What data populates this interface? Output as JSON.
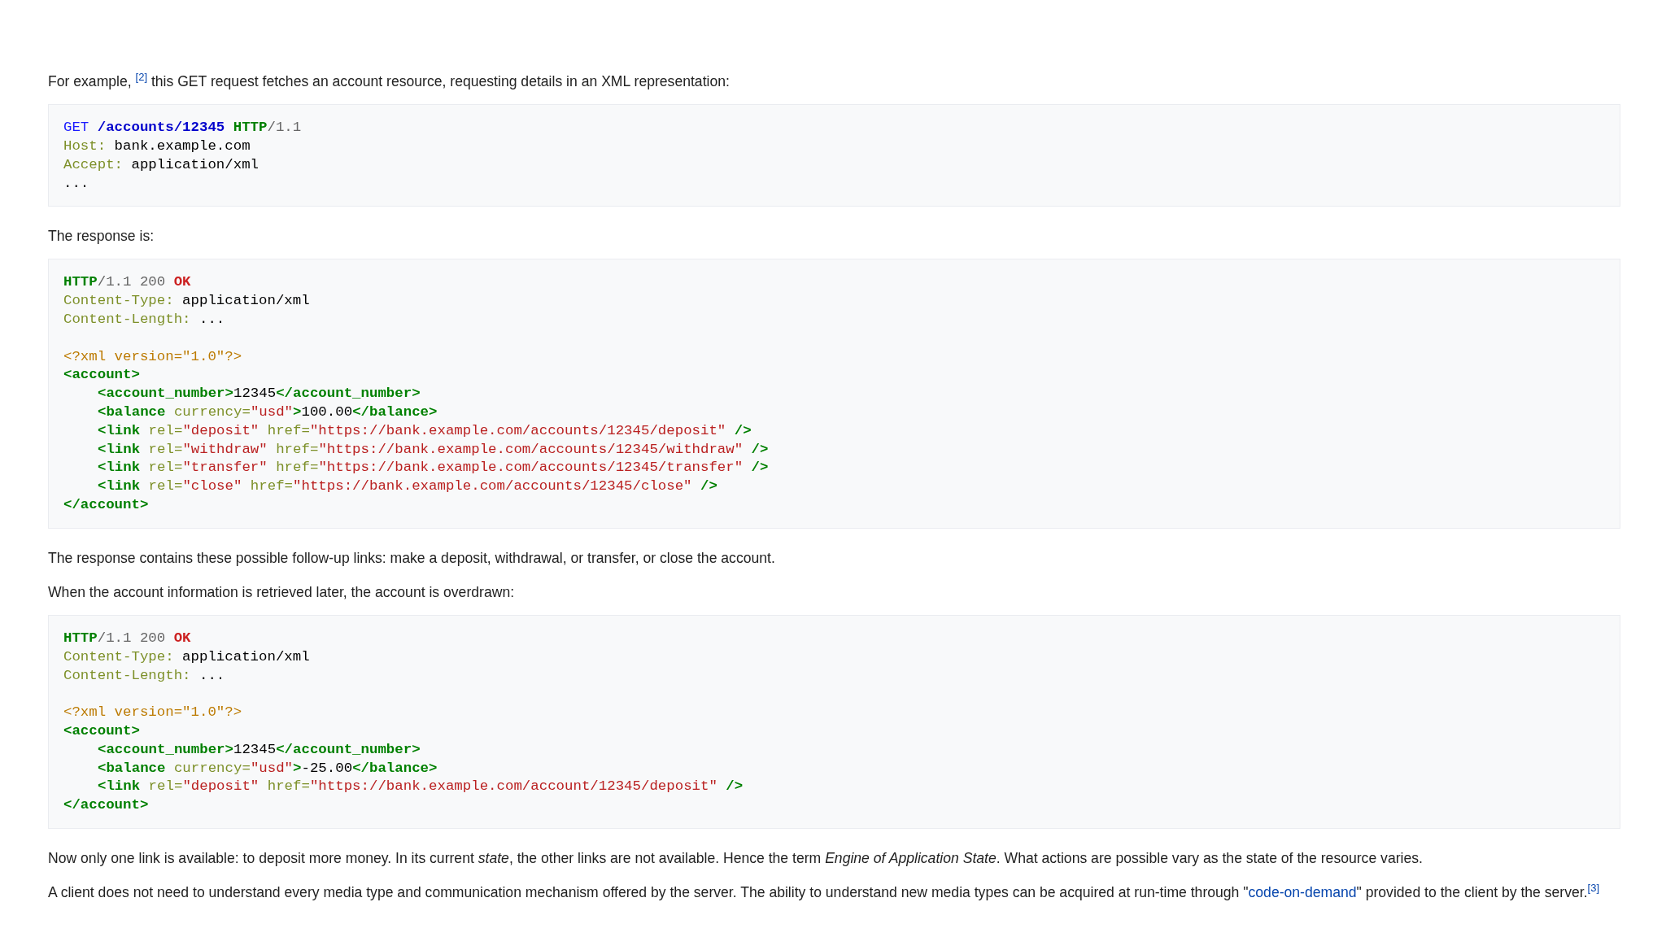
{
  "content": [
    {
      "kind": "paragraph",
      "segments": [
        {
          "kind": "text",
          "text": "For example, "
        },
        {
          "kind": "ref",
          "text": "[2]"
        },
        {
          "kind": "text",
          "text": " this GET request fetches an account resource, requesting details in an XML representation:"
        }
      ]
    },
    {
      "kind": "code",
      "lines": [
        {
          "kind": "code",
          "indented": false,
          "tokens": [
            {
              "kind": "method",
              "text": "GET "
            },
            {
              "kind": "path",
              "text": "/accounts/12345"
            },
            {
              "kind": "tag",
              "text": " HTTP"
            },
            {
              "kind": "version",
              "text": "/1.1"
            }
          ]
        },
        {
          "kind": "code",
          "indented": false,
          "tokens": [
            {
              "kind": "attr",
              "text": "Host:"
            },
            {
              "kind": "text",
              "text": " bank.example.com"
            }
          ]
        },
        {
          "kind": "code",
          "indented": false,
          "tokens": [
            {
              "kind": "attr",
              "text": "Accept:"
            },
            {
              "kind": "text",
              "text": " application/xml"
            }
          ]
        },
        {
          "kind": "code",
          "indented": false,
          "tokens": [
            {
              "kind": "text",
              "text": "..."
            }
          ]
        }
      ]
    },
    {
      "kind": "paragraph",
      "segments": [
        {
          "kind": "text",
          "text": "The response is:"
        }
      ]
    },
    {
      "kind": "code",
      "lines": [
        {
          "kind": "code",
          "indented": false,
          "tokens": [
            {
              "kind": "tag",
              "text": "HTTP"
            },
            {
              "kind": "version",
              "text": "/1.1 200 "
            },
            {
              "kind": "status",
              "text": "OK"
            }
          ]
        },
        {
          "kind": "code",
          "indented": false,
          "tokens": [
            {
              "kind": "attr",
              "text": "Content-Type:"
            },
            {
              "kind": "text",
              "text": " application/xml"
            }
          ]
        },
        {
          "kind": "code",
          "indented": false,
          "tokens": [
            {
              "kind": "attr",
              "text": "Content-Length:"
            },
            {
              "kind": "text",
              "text": " ..."
            }
          ]
        },
        {
          "kind": "blank"
        },
        {
          "kind": "code",
          "indented": false,
          "tokens": [
            {
              "kind": "decl",
              "text": "<?xml version=\"1.0\"?>"
            }
          ]
        },
        {
          "kind": "code",
          "indented": false,
          "tokens": [
            {
              "kind": "tag",
              "text": "<account>"
            }
          ]
        },
        {
          "kind": "code",
          "indented": true,
          "tokens": [
            {
              "kind": "tag",
              "text": "<account_number>"
            },
            {
              "kind": "text",
              "text": "12345"
            },
            {
              "kind": "tag",
              "text": "</account_number>"
            }
          ]
        },
        {
          "kind": "code",
          "indented": true,
          "tokens": [
            {
              "kind": "tag",
              "text": "<balance"
            },
            {
              "kind": "attr",
              "text": " currency="
            },
            {
              "kind": "string",
              "text": "\"usd\""
            },
            {
              "kind": "tag",
              "text": ">"
            },
            {
              "kind": "text",
              "text": "100.00"
            },
            {
              "kind": "tag",
              "text": "</balance>"
            }
          ]
        },
        {
          "kind": "code",
          "indented": true,
          "tokens": [
            {
              "kind": "tag",
              "text": "<link"
            },
            {
              "kind": "attr",
              "text": " rel="
            },
            {
              "kind": "string",
              "text": "\"deposit\""
            },
            {
              "kind": "attr",
              "text": " href="
            },
            {
              "kind": "string",
              "text": "\"https://bank.example.com/accounts/12345/deposit\""
            },
            {
              "kind": "tag",
              "text": " />"
            }
          ]
        },
        {
          "kind": "code",
          "indented": true,
          "tokens": [
            {
              "kind": "tag",
              "text": "<link"
            },
            {
              "kind": "attr",
              "text": " rel="
            },
            {
              "kind": "string",
              "text": "\"withdraw\""
            },
            {
              "kind": "attr",
              "text": " href="
            },
            {
              "kind": "string",
              "text": "\"https://bank.example.com/accounts/12345/withdraw\""
            },
            {
              "kind": "tag",
              "text": " />"
            }
          ]
        },
        {
          "kind": "code",
          "indented": true,
          "tokens": [
            {
              "kind": "tag",
              "text": "<link"
            },
            {
              "kind": "attr",
              "text": " rel="
            },
            {
              "kind": "string",
              "text": "\"transfer\""
            },
            {
              "kind": "attr",
              "text": " href="
            },
            {
              "kind": "string",
              "text": "\"https://bank.example.com/accounts/12345/transfer\""
            },
            {
              "kind": "tag",
              "text": " />"
            }
          ]
        },
        {
          "kind": "code",
          "indented": true,
          "tokens": [
            {
              "kind": "tag",
              "text": "<link"
            },
            {
              "kind": "attr",
              "text": " rel="
            },
            {
              "kind": "string",
              "text": "\"close\""
            },
            {
              "kind": "attr",
              "text": " href="
            },
            {
              "kind": "string",
              "text": "\"https://bank.example.com/accounts/12345/close\""
            },
            {
              "kind": "tag",
              "text": " />"
            }
          ]
        },
        {
          "kind": "code",
          "indented": false,
          "tokens": [
            {
              "kind": "tag",
              "text": "</account>"
            }
          ]
        }
      ]
    },
    {
      "kind": "paragraph",
      "segments": [
        {
          "kind": "text",
          "text": "The response contains these possible follow-up links: make a deposit, withdrawal, or transfer, or close the account."
        }
      ]
    },
    {
      "kind": "paragraph",
      "segments": [
        {
          "kind": "text",
          "text": "When the account information is retrieved later, the account is overdrawn:"
        }
      ]
    },
    {
      "kind": "code",
      "lines": [
        {
          "kind": "code",
          "indented": false,
          "tokens": [
            {
              "kind": "tag",
              "text": "HTTP"
            },
            {
              "kind": "version",
              "text": "/1.1 200 "
            },
            {
              "kind": "status",
              "text": "OK"
            }
          ]
        },
        {
          "kind": "code",
          "indented": false,
          "tokens": [
            {
              "kind": "attr",
              "text": "Content-Type:"
            },
            {
              "kind": "text",
              "text": " application/xml"
            }
          ]
        },
        {
          "kind": "code",
          "indented": false,
          "tokens": [
            {
              "kind": "attr",
              "text": "Content-Length:"
            },
            {
              "kind": "text",
              "text": " ..."
            }
          ]
        },
        {
          "kind": "blank"
        },
        {
          "kind": "code",
          "indented": false,
          "tokens": [
            {
              "kind": "decl",
              "text": "<?xml version=\"1.0\"?>"
            }
          ]
        },
        {
          "kind": "code",
          "indented": false,
          "tokens": [
            {
              "kind": "tag",
              "text": "<account>"
            }
          ]
        },
        {
          "kind": "code",
          "indented": true,
          "tokens": [
            {
              "kind": "tag",
              "text": "<account_number>"
            },
            {
              "kind": "text",
              "text": "12345"
            },
            {
              "kind": "tag",
              "text": "</account_number>"
            }
          ]
        },
        {
          "kind": "code",
          "indented": true,
          "tokens": [
            {
              "kind": "tag",
              "text": "<balance"
            },
            {
              "kind": "attr",
              "text": " currency="
            },
            {
              "kind": "string",
              "text": "\"usd\""
            },
            {
              "kind": "tag",
              "text": ">"
            },
            {
              "kind": "text",
              "text": "-25.00"
            },
            {
              "kind": "tag",
              "text": "</balance>"
            }
          ]
        },
        {
          "kind": "code",
          "indented": true,
          "tokens": [
            {
              "kind": "tag",
              "text": "<link"
            },
            {
              "kind": "attr",
              "text": " rel="
            },
            {
              "kind": "string",
              "text": "\"deposit\""
            },
            {
              "kind": "attr",
              "text": " href="
            },
            {
              "kind": "string",
              "text": "\"https://bank.example.com/account/12345/deposit\""
            },
            {
              "kind": "tag",
              "text": " />"
            }
          ]
        },
        {
          "kind": "code",
          "indented": false,
          "tokens": [
            {
              "kind": "tag",
              "text": "</account>"
            }
          ]
        }
      ]
    },
    {
      "kind": "paragraph",
      "segments": [
        {
          "kind": "text",
          "text": "Now only one link is available: to deposit more money. In its current *state*, the other links are not available. Hence the term *Engine of Application State*. What actions are possible vary as the state of the resource varies."
        }
      ]
    },
    {
      "kind": "paragraph",
      "segments": [
        {
          "kind": "text",
          "text": "A client does not need to understand every media type and communication mechanism offered by the server. The ability to understand new media types can be acquired at run-time through \""
        },
        {
          "kind": "link",
          "text": "code-on-demand"
        },
        {
          "kind": "text",
          "text": "\" provided to the client by the server."
        },
        {
          "kind": "ref",
          "text": "[3]"
        }
      ]
    }
  ]
}
